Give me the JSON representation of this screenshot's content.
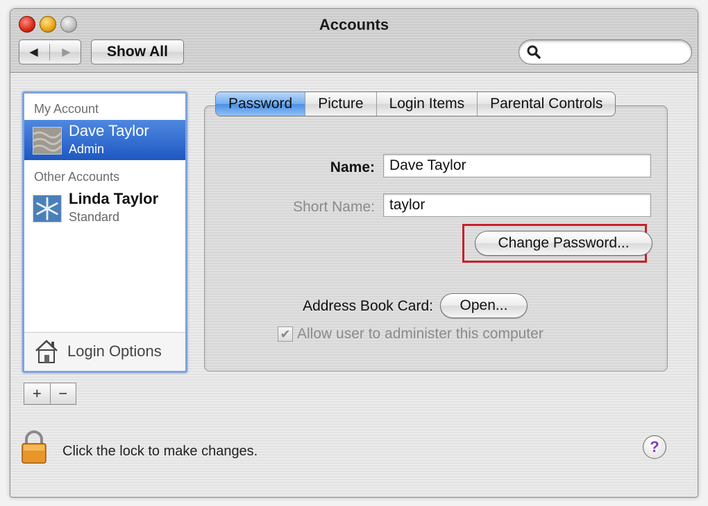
{
  "window": {
    "title": "Accounts"
  },
  "toolbar": {
    "back_icon": "left-arrow-icon",
    "forward_icon": "right-arrow-icon",
    "show_all_label": "Show All",
    "search_value": ""
  },
  "accounts": {
    "my_account_header": "My Account",
    "other_accounts_header": "Other Accounts",
    "items": [
      {
        "name": "Dave Taylor",
        "role": "Admin",
        "selected": true
      },
      {
        "name": "Linda Taylor",
        "role": "Standard",
        "selected": false
      }
    ],
    "login_options_label": "Login Options",
    "add_label": "+",
    "remove_label": "−"
  },
  "tabs": [
    {
      "label": "Password",
      "active": true
    },
    {
      "label": "Picture",
      "active": false
    },
    {
      "label": "Login Items",
      "active": false
    },
    {
      "label": "Parental Controls",
      "active": false
    }
  ],
  "password_tab": {
    "name_label": "Name:",
    "name_value": "Dave Taylor",
    "short_name_label": "Short Name:",
    "short_name_value": "taylor",
    "change_password_label": "Change Password...",
    "address_book_label": "Address Book Card:",
    "open_label": "Open...",
    "allow_admin_label": "Allow user to administer this computer",
    "allow_admin_checked": true
  },
  "footer": {
    "lock_text": "Click the lock to make changes.",
    "help_label": "?"
  },
  "colors": {
    "selection": "#1e58c2",
    "highlight_box": "#c8202a",
    "active_tab": "#4a90e6"
  }
}
